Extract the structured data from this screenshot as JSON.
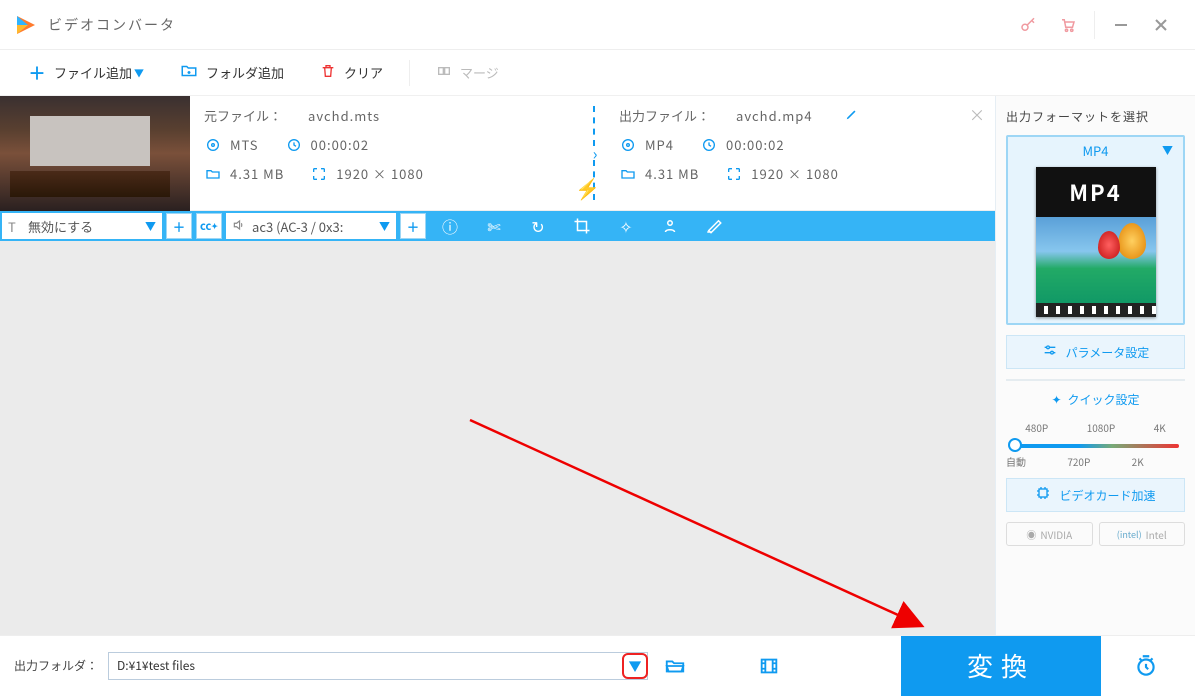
{
  "app": {
    "title": "ビデオコンバータ"
  },
  "toolbar": {
    "add_file": "ファイル追加",
    "add_folder": "フォルダ追加",
    "clear": "クリア",
    "merge": "マージ"
  },
  "file": {
    "source_label": "元ファイル：",
    "source_name": "avchd.mts",
    "output_label": "出力ファイル：",
    "output_name": "avchd.mp4",
    "src_format": "MTS",
    "src_duration": "00:00:02",
    "src_size": "4.31 MB",
    "src_resolution": "1920 × 1080",
    "out_format": "MP4",
    "out_duration": "00:00:02",
    "out_size": "4.31 MB",
    "out_resolution": "1920 × 1080"
  },
  "editbar": {
    "subtitle_value": "無効にする",
    "audio_value": "ac3 (AC-3 / 0x3:"
  },
  "right_panel": {
    "title": "出力フォーマットを選択",
    "format": "MP4",
    "format_label": "MP4",
    "param_settings": "パラメータ設定",
    "quick_settings": "クイック設定",
    "presets": {
      "p480": "480P",
      "p1080": "1080P",
      "p4k": "4K",
      "auto": "自動",
      "p720": "720P",
      "p2k": "2K"
    },
    "gpu_accel": "ビデオカード加速",
    "nvidia": "NVIDIA",
    "intel": "Intel"
  },
  "bottom": {
    "output_folder_label": "出力フォルダ：",
    "output_folder_value": "D:¥1¥test files",
    "convert": "変換"
  }
}
